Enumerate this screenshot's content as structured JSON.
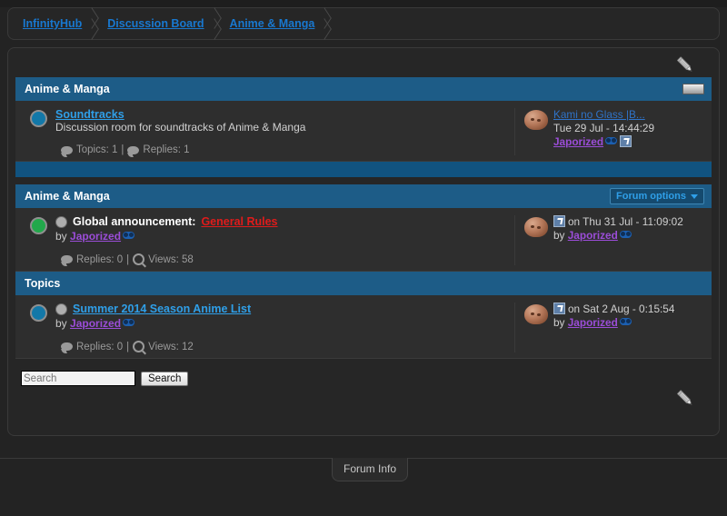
{
  "breadcrumb": [
    {
      "label": "InfinityHub"
    },
    {
      "label": "Discussion Board"
    },
    {
      "label": "Anime & Manga"
    }
  ],
  "colors": {
    "header_blue": "#1d5c87",
    "link_blue": "#2f9fe8",
    "crumb_blue": "#1878d0",
    "user_purple": "#9b4dd8",
    "announce_red": "#e01b1b",
    "page_bg": "#232323",
    "row_bg": "#2e2e2e"
  },
  "category": {
    "title": "Anime & Manga",
    "collapse_icon": "minus-icon",
    "forums": [
      {
        "status_icon": "forum-unread-dot",
        "title": "Soundtracks",
        "description": "Discussion room for soundtracks of Anime & Manga",
        "topics_label": "Topics: 1",
        "separator": "|",
        "replies_label": "Replies: 1",
        "last_post": {
          "title": "Kami no Glass |B...",
          "date": "Tue 29 Jul - 14:44:29",
          "author": "Japorized",
          "goto_icon": "goto-last-post-icon"
        }
      }
    ]
  },
  "forum": {
    "title": "Anime & Manga",
    "options_button": "Forum options",
    "options_chevron": "chevron-down-icon",
    "announcements": [
      {
        "status_icon": "topic-read-dot",
        "prefix": "Global announcement:",
        "title": "General Rules",
        "by_label": "by",
        "author": "Japorized",
        "replies_label": "Replies: 0",
        "separator": "|",
        "views_label": "Views: 58",
        "last_post": {
          "goto_icon": "goto-last-post-icon",
          "date": "on Thu 31 Jul - 11:09:02",
          "by_label": "by",
          "author": "Japorized"
        }
      }
    ],
    "topics_header": "Topics",
    "topics": [
      {
        "status_icon": "topic-unread-dot",
        "title": "Summer 2014 Season Anime List",
        "by_label": "by",
        "author": "Japorized",
        "replies_label": "Replies: 0",
        "separator": "|",
        "views_label": "Views: 12",
        "last_post": {
          "goto_icon": "goto-last-post-icon",
          "date": "on Sat 2 Aug - 0:15:54",
          "by_label": "by",
          "author": "Japorized"
        }
      }
    ]
  },
  "search": {
    "placeholder": "Search",
    "value": "",
    "button_label": "Search"
  },
  "edit_icons": {
    "top": "pencil-icon",
    "bottom": "pencil-icon"
  },
  "footer": {
    "tab_label": "Forum Info"
  }
}
